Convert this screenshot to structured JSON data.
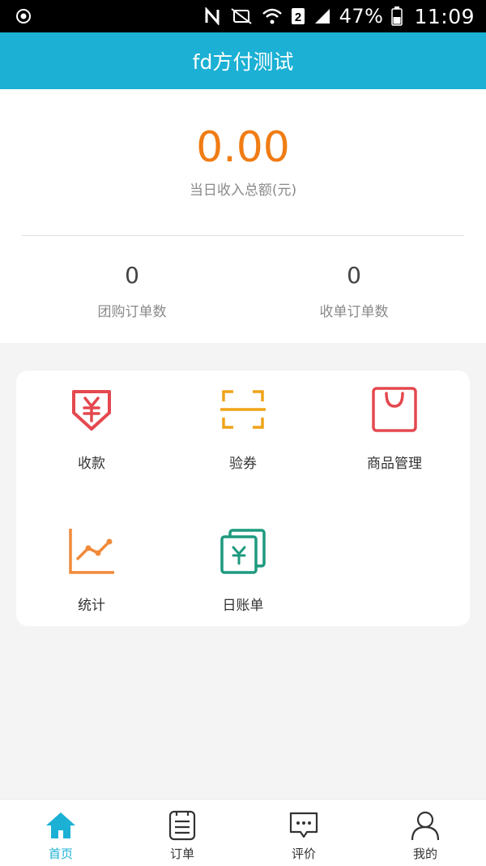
{
  "status_bar": {
    "battery": "47%",
    "time": "11:09",
    "sim_label": "2",
    "icons": [
      "settings-icon",
      "nfc-icon",
      "mute-icon",
      "wifi-icon",
      "sim-icon",
      "signal-icon",
      "battery-icon"
    ]
  },
  "app_bar": {
    "title": "fd方付测试"
  },
  "summary": {
    "amount": "0.00",
    "amount_label": "当日收入总额(元)",
    "group_orders": {
      "value": "0",
      "label": "团购订单数"
    },
    "pay_orders": {
      "value": "0",
      "label": "收单订单数"
    }
  },
  "grid": [
    {
      "label": "收款",
      "icon": "receive-payment-icon",
      "color": "#e4484e"
    },
    {
      "label": "验券",
      "icon": "scan-coupon-icon",
      "color": "#f0a318"
    },
    {
      "label": "商品管理",
      "icon": "shopping-bag-icon",
      "color": "#e4484e"
    },
    {
      "label": "统计",
      "icon": "line-chart-icon",
      "color": "#f08a3a"
    },
    {
      "label": "日账单",
      "icon": "daily-bill-icon",
      "color": "#1e9a7e"
    }
  ],
  "tabs": [
    {
      "label": "首页",
      "icon": "home-icon",
      "active": true
    },
    {
      "label": "订单",
      "icon": "orders-icon",
      "active": false
    },
    {
      "label": "评价",
      "icon": "comment-icon",
      "active": false
    },
    {
      "label": "我的",
      "icon": "user-icon",
      "active": false
    }
  ],
  "colors": {
    "accent": "#1bb0d4",
    "amount": "#f07c14",
    "background": "#f4f4f4"
  }
}
